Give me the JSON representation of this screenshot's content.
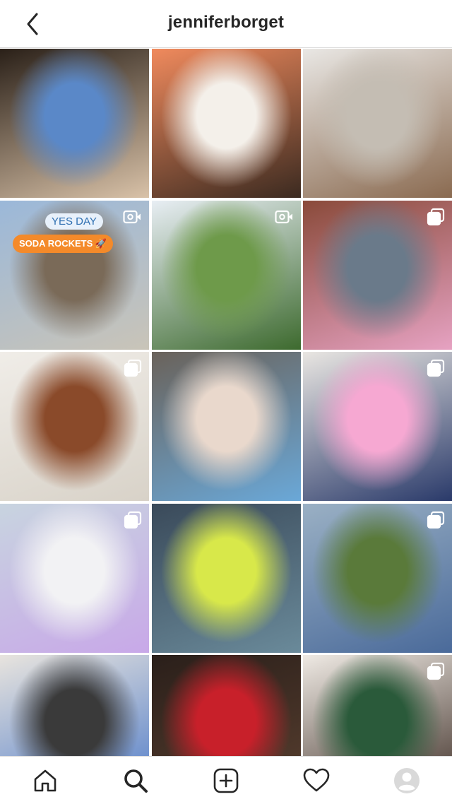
{
  "header": {
    "back_icon": "chevron-left-icon",
    "username": "jenniferborget"
  },
  "grid": {
    "tiles": [
      {
        "name": "post-1",
        "badge": "none",
        "colors": [
          "#2a2018",
          "#5a88c8",
          "#d9c2a8"
        ]
      },
      {
        "name": "post-2",
        "badge": "none",
        "colors": [
          "#f08a5d",
          "#f4f0ea",
          "#3b2a20"
        ]
      },
      {
        "name": "post-3",
        "badge": "none",
        "colors": [
          "#e9e7e4",
          "#c4bdb3",
          "#8a6a50"
        ]
      },
      {
        "name": "post-4",
        "badge": "video-icon",
        "colors": [
          "#9bb8d9",
          "#7a6a58",
          "#c9c4b8"
        ],
        "stickers": {
          "yes_day": "YES DAY",
          "soda_rockets": "SODA ROCKETS 🚀"
        }
      },
      {
        "name": "post-5",
        "badge": "video-icon",
        "colors": [
          "#e8eef4",
          "#6e9a4a",
          "#3d6a2e"
        ]
      },
      {
        "name": "post-6",
        "badge": "carousel-icon",
        "colors": [
          "#8a4a3a",
          "#6a7a8a",
          "#e6a2c2"
        ]
      },
      {
        "name": "post-7",
        "badge": "carousel-icon",
        "colors": [
          "#f0ede8",
          "#8a4a2a",
          "#d8d2c8"
        ]
      },
      {
        "name": "post-8",
        "badge": "none",
        "colors": [
          "#6a625a",
          "#e9d8cc",
          "#6aa8d8"
        ]
      },
      {
        "name": "post-9",
        "badge": "carousel-icon",
        "colors": [
          "#e9e6e2",
          "#f6a8d2",
          "#2a3a6a"
        ]
      },
      {
        "name": "post-10",
        "badge": "carousel-icon",
        "colors": [
          "#c8d4e0",
          "#f2f2f4",
          "#c8a8e8"
        ]
      },
      {
        "name": "post-11",
        "badge": "none",
        "colors": [
          "#3a4a5a",
          "#d8e84a",
          "#6a8a9a"
        ]
      },
      {
        "name": "post-12",
        "badge": "carousel-icon",
        "colors": [
          "#9ab0c4",
          "#5a7a3a",
          "#4a6a9a"
        ]
      },
      {
        "name": "post-13",
        "badge": "none",
        "colors": [
          "#e8e4de",
          "#3a3a3a",
          "#4a78c8"
        ]
      },
      {
        "name": "post-14",
        "badge": "none",
        "colors": [
          "#2a1f1a",
          "#c8202a",
          "#5a4030"
        ]
      },
      {
        "name": "post-15",
        "badge": "carousel-icon",
        "colors": [
          "#efeae4",
          "#2a5a3a",
          "#3a2a22"
        ]
      }
    ]
  },
  "tabbar": {
    "items": [
      {
        "name": "tab-home",
        "icon": "home-icon"
      },
      {
        "name": "tab-search",
        "icon": "search-icon",
        "active": true
      },
      {
        "name": "tab-new-post",
        "icon": "add-post-icon"
      },
      {
        "name": "tab-activity",
        "icon": "heart-icon"
      },
      {
        "name": "tab-profile",
        "icon": "avatar-icon"
      }
    ]
  }
}
